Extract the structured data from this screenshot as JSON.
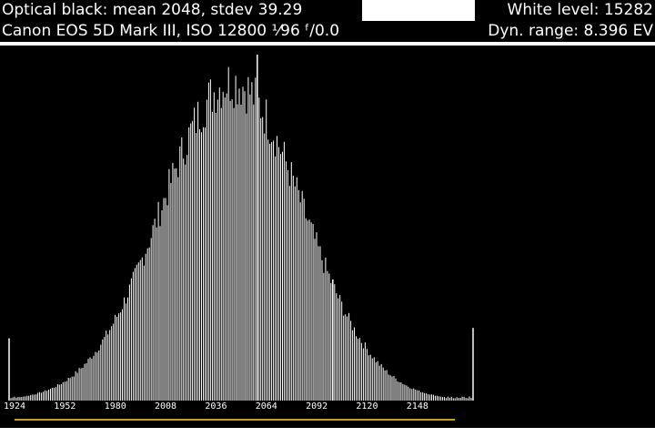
{
  "header": {
    "optical_black": "Optical black: mean 2048, stdev 39.29",
    "white_level": "White level: 15282",
    "camera_info": "Canon EOS 5D Mark III, ISO 12800 ¹⁄96 ᶠ/0.0",
    "dyn_range": "Dyn. range: 8.396 EV"
  },
  "colors": {
    "bars": "#ffffff",
    "range_bar": "#c8a000",
    "background": "#000000"
  },
  "chart_data": {
    "type": "bar",
    "title": "",
    "xlabel": "",
    "ylabel": "",
    "x_ticks": [
      "1924",
      "1952",
      "1980",
      "2008",
      "2036",
      "2064",
      "2092",
      "2120",
      "2148"
    ],
    "x_range": [
      1924,
      2182
    ],
    "mean": 2048,
    "stdev": 39.29,
    "outliers": [
      {
        "x": 1924,
        "value": 0.18
      },
      {
        "x": 2062,
        "value": 1.0
      },
      {
        "x": 2104,
        "value": 0.35
      },
      {
        "x": 2182,
        "value": 0.21
      }
    ],
    "range_bar": {
      "from": 1927,
      "to": 2172
    }
  }
}
